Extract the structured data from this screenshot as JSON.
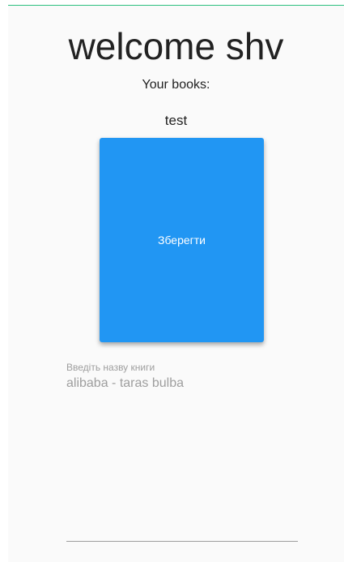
{
  "header": {
    "welcome_text": "welcome shv",
    "books_label": "Your books:"
  },
  "books": [
    {
      "title": "test"
    }
  ],
  "save_button": {
    "label": "Зберегти"
  },
  "book_name_field": {
    "hint": "Введіть назву книги",
    "value": "alibaba - taras bulba"
  },
  "colors": {
    "accent": "#2196f3",
    "top_line": "#2bbf7f",
    "hint_text": "#9e9e9e"
  }
}
